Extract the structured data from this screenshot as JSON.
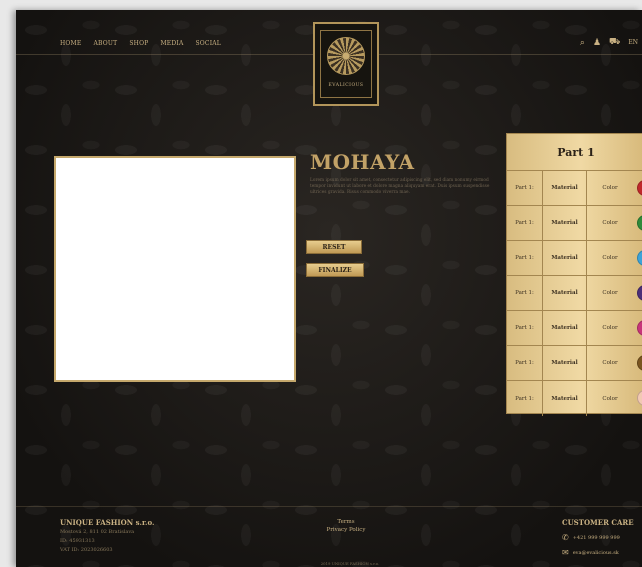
{
  "nav": [
    "HOME",
    "ABOUT",
    "SHOP",
    "MEDIA",
    "SOCIAL"
  ],
  "logo": {
    "text": "EVALICIOUS"
  },
  "header_icons": {
    "search": "search-icon",
    "user": "user-icon",
    "cart": "cart-icon",
    "lang": "EN"
  },
  "product": {
    "title": "MOHAYA",
    "description": "Lorem ipsum dolor sit amet, consectetur adipiscing elit, sed diam nonumy eirmod tempor invidunt ut labore et dolore magna aliquyam erat. Duis ipsum suspendisse ultrices gravida. Risus commodo viverra mae."
  },
  "buttons": {
    "reset": "RESET",
    "finalize": "FINALIZE"
  },
  "parts_panel": {
    "title": "Part 1",
    "rows": [
      {
        "part": "Part 1:",
        "material": "Material",
        "color_label": "Color",
        "swatch": "#c0282b"
      },
      {
        "part": "Part 1:",
        "material": "Material",
        "color_label": "Color",
        "swatch": "#2f8a3a"
      },
      {
        "part": "Part 1:",
        "material": "Material",
        "color_label": "Color",
        "swatch": "#3da3d8"
      },
      {
        "part": "Part 1:",
        "material": "Material",
        "color_label": "Color",
        "swatch": "#4b2f78"
      },
      {
        "part": "Part 1:",
        "material": "Material",
        "color_label": "Color",
        "swatch": "#c8357a"
      },
      {
        "part": "Part 1:",
        "material": "Material",
        "color_label": "Color",
        "swatch": "#7a5520"
      },
      {
        "part": "Part 1:",
        "material": "Material",
        "color_label": "Color",
        "swatch": "#f2c9b3"
      }
    ]
  },
  "footer": {
    "company": "UNIQUE FASHION s.r.o.",
    "address": "Mostová 2, 811 02 Bratislava",
    "id": "ID: 45931313",
    "vat": "VAT ID: 2023026603",
    "terms": "Terms",
    "privacy": "Privacy Policy",
    "copyright": "2019 UNIQUE FASHION s.r.o.",
    "care_title": "CUSTOMER CARE",
    "phone": "+421 999 999 999",
    "email": "eva@evalicious.sk"
  }
}
